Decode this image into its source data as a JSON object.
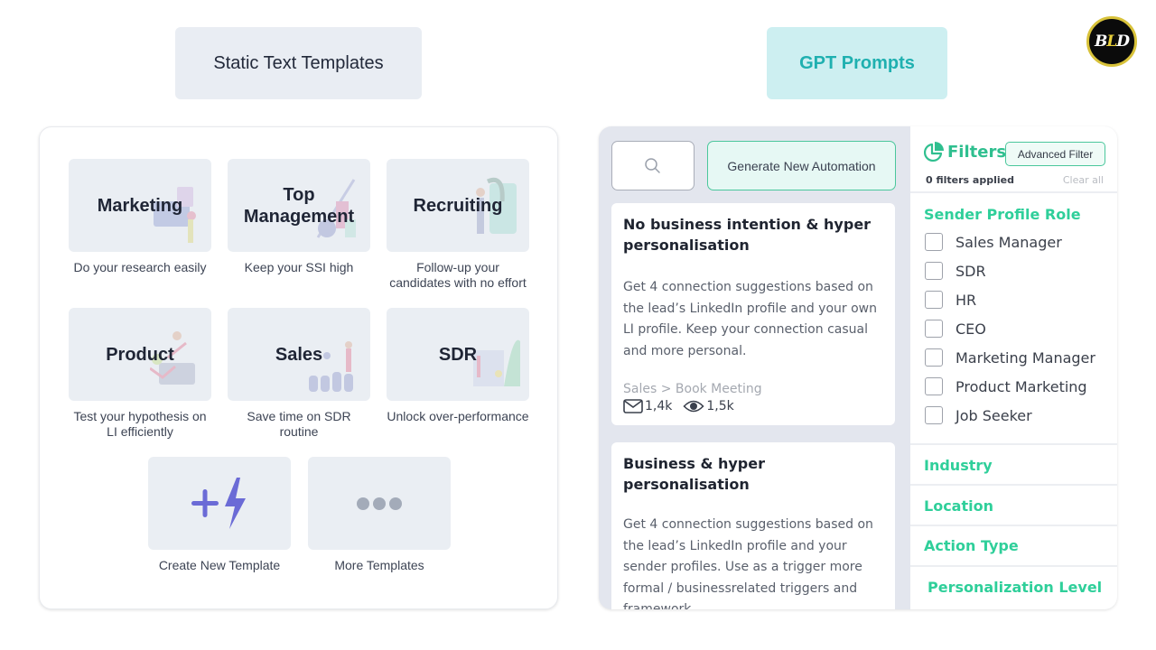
{
  "tabs": {
    "static": "Static Text Templates",
    "gpt": "GPT Prompts"
  },
  "logo": {
    "left": "B",
    "mid": "L",
    "right": "D"
  },
  "templates": [
    {
      "title": "Marketing",
      "desc": "Do your research easily"
    },
    {
      "title": "Top Management",
      "desc": "Keep your SSI high"
    },
    {
      "title": "Recruiting",
      "desc": "Follow-up your candidates with no effort"
    },
    {
      "title": "Product",
      "desc": "Test your hypothesis on LI efficiently"
    },
    {
      "title": "Sales",
      "desc": "Save time on SDR routine"
    },
    {
      "title": "SDR",
      "desc": "Unlock over-performance"
    },
    {
      "title": "",
      "desc": "Create New Template",
      "icon": "plus-lightning-icon"
    },
    {
      "title": "",
      "desc": "More Templates",
      "icon": "more-dots-icon"
    }
  ],
  "gpt": {
    "search_icon": "search-icon",
    "generate_label": "Generate New Automation",
    "prompts": [
      {
        "title": "No business intention & hyper personalisation",
        "body": "Get 4 connection suggestions based on the lead’s LinkedIn profile and your own LI profile. Keep your connection casual and more personal.",
        "category": "Sales > Book Meeting",
        "sent": "1,4k",
        "views": "1,5k"
      },
      {
        "title": "Business & hyper personalisation",
        "body": "Get 4 connection suggestions based on the lead’s LinkedIn profile and your sender profiles. Use as a trigger more formal / businessrelated triggers and framework."
      }
    ],
    "filters": {
      "title": "Filters",
      "advanced_label": "Advanced Filter",
      "applied": "0 filters applied",
      "clear": "Clear all",
      "role_title": "Sender Profile Role",
      "roles": [
        "Sales Manager",
        "SDR",
        "HR",
        "CEO",
        "Marketing Manager",
        "Product Marketing",
        "Job Seeker"
      ],
      "sections": [
        "Industry",
        "Location",
        "Action Type",
        "Personalization Level"
      ]
    }
  },
  "colors": {
    "accent_green": "#2fcf9a",
    "gpt_teal": "#1fb0b0",
    "create_icon": "#6b6bd6"
  }
}
